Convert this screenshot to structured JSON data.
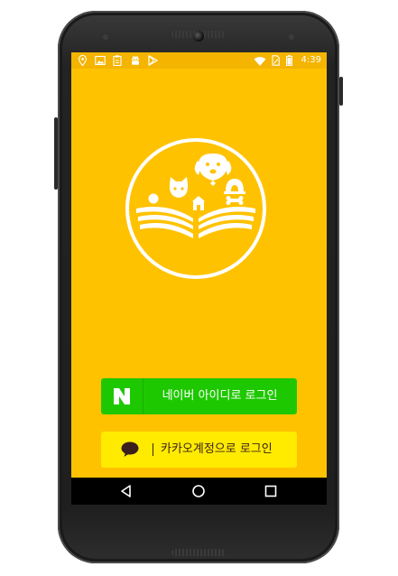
{
  "status_bar": {
    "time": "4:39",
    "icons": [
      "location-icon",
      "image-icon",
      "clipboard-icon",
      "android-icon",
      "play-store-icon",
      "wifi-icon",
      "sim-icon",
      "battery-icon"
    ]
  },
  "logo": {
    "icon": "open-book-with-pets-logo"
  },
  "login": {
    "naver_label": "네이버 아이디로 로그인",
    "naver_mark": "N",
    "naver_color": "#1ec800",
    "kakao_label": "카카오계정으로 로그인",
    "kakao_separator": "|",
    "kakao_color": "#ffeb00"
  },
  "navigation": {
    "icons": [
      "back-icon",
      "home-icon",
      "recents-icon"
    ]
  },
  "theme": {
    "background": "#ffc200",
    "status_bar": "#f4b400"
  }
}
